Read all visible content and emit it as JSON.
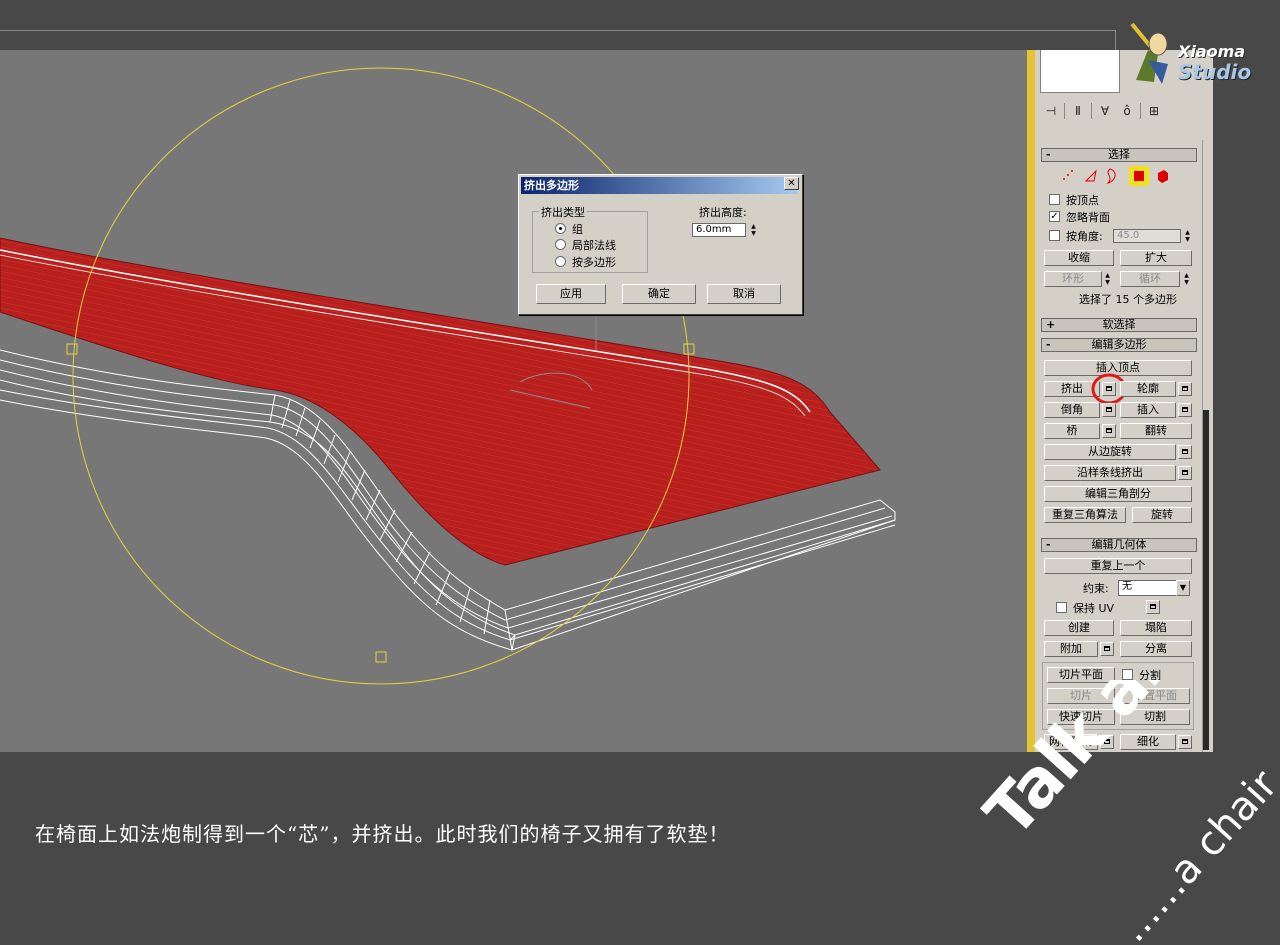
{
  "caption": "在椅面上如法炮制得到一个“芯”，并挤出。此时我们的椅子又拥有了软垫！",
  "logo": {
    "line1": "Xiaoma",
    "line2": "Studio"
  },
  "watermark": {
    "line1": "Talk about",
    "line2": "......a chair"
  },
  "dialog": {
    "title": "挤出多边形",
    "close": "✕",
    "group_label": "挤出类型",
    "options": [
      "组",
      "局部法线",
      "按多边形"
    ],
    "height_label": "挤出高度:",
    "height_value": "6.0mm",
    "buttons": {
      "apply": "应用",
      "ok": "确定",
      "cancel": "取消"
    }
  },
  "panel": {
    "selection": {
      "title": "选择",
      "sign": "-",
      "by_vertex": "按顶点",
      "ignore_backface": "忽略背面",
      "by_angle": "按角度:",
      "angle_value": "45.0",
      "shrink": "收缩",
      "grow": "扩大",
      "ring": "环形",
      "loop": "循环",
      "status": "选择了 15 个多边形",
      "check": "✓"
    },
    "soft_selection": {
      "title": "软选择",
      "sign": "+"
    },
    "edit_polygons": {
      "title": "编辑多边形",
      "sign": "-",
      "insert_vertex": "插入顶点",
      "extrude": "挤出",
      "outline": "轮廓",
      "bevel": "倒角",
      "inset": "插入",
      "bridge": "桥",
      "flip": "翻转",
      "hinge": "从边旋转",
      "extrude_along_spline": "沿样条线挤出",
      "edit_triangulation": "编辑三角剖分",
      "retriangulate": "重复三角算法",
      "turn": "旋转"
    },
    "edit_geometry": {
      "title": "编辑几何体",
      "sign": "-",
      "repeat_last": "重复上一个",
      "constraints_label": "约束:",
      "constraints_value": "无",
      "preserve_uv": "保持 UV",
      "create": "创建",
      "collapse": "塌陷",
      "attach": "附加",
      "detach": "分离",
      "slice_plane": "切片平面",
      "split": "分割",
      "slice": "切片",
      "reset_plane": "重置平面",
      "quickslice": "快速切片",
      "cut": "切割",
      "meshsmooth": "网格平滑",
      "tessellate": "细化"
    }
  },
  "colors": {
    "polygon_fill": "#b8201e",
    "wire": "#ffffff",
    "gizmo": "#e6d23c",
    "highlight_ring": "#e01818",
    "viewport_bg": "#777777"
  }
}
